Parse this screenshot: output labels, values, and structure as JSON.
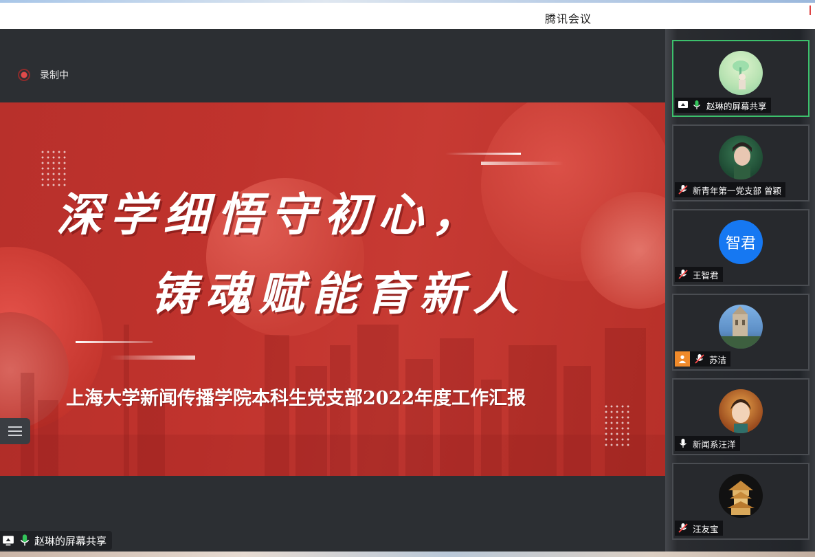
{
  "window": {
    "title": "腾讯会议"
  },
  "recording": {
    "label": "录制中"
  },
  "slide": {
    "title_line1": "深学细悟守初心，",
    "title_line2": "铸魂赋能育新人",
    "subtitle": "上海大学新闻传播学院本科生党支部2022年度工作汇报"
  },
  "share_indicator": {
    "label": "赵琳的屏幕共享",
    "icons": [
      "screen-share-icon",
      "mic-on-icon"
    ]
  },
  "participants": [
    {
      "name": "赵琳的屏幕共享",
      "avatar": "image",
      "active": true,
      "icons": [
        "screen-share-icon",
        "mic-on-icon"
      ]
    },
    {
      "name": "新青年第一党支部 曾颖",
      "avatar": "image",
      "active": false,
      "icons": [
        "mic-muted-icon"
      ]
    },
    {
      "name": "王智君",
      "avatar_text": "智君",
      "active": false,
      "icons": [
        "mic-muted-icon"
      ]
    },
    {
      "name": "苏洁",
      "avatar": "image",
      "active": false,
      "icons": [
        "host-icon",
        "mic-muted-icon"
      ]
    },
    {
      "name": "新闻系汪洋",
      "avatar": "image",
      "active": false,
      "icons": [
        "mic-on-icon"
      ]
    },
    {
      "name": "汪友宝",
      "avatar": "image",
      "active": false,
      "icons": [
        "mic-muted-icon"
      ]
    }
  ],
  "colors": {
    "active_border": "#3cc06c",
    "avatar_blue": "#1678f2",
    "slide_red": "#c0332d"
  }
}
